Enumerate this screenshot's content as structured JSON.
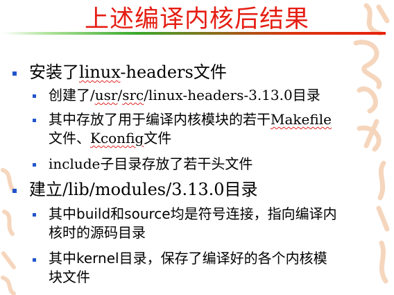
{
  "slide": {
    "title": "上述编译内核后结果",
    "items": [
      {
        "pre": "安装了",
        "code": "linux",
        "post": "-headers文件",
        "children": [
          {
            "pre": "创建了/",
            "code1": "usr",
            "mid": "/",
            "code2": "src",
            "post": "/linux-headers-3.13.0目录"
          },
          {
            "line1_pre": "其中存放了用于编译内核模块的若干",
            "line1_code": "Makefile",
            "line2_pre": "文件、",
            "line2_code": "Kconfig",
            "line2_post": "文件"
          },
          {
            "text": "include子目录存放了若干头文件"
          }
        ]
      },
      {
        "text": "建立/lib/modules/3.13.0目录",
        "children": [
          {
            "line1": "其中build和source均是符号连接，指向编译内",
            "line2": "核时的源码目录"
          },
          {
            "line1": "其中kernel目录，保存了编译好的各个内核模",
            "line2": "块文件"
          }
        ]
      }
    ]
  },
  "colors": {
    "title": "#e51d12",
    "bullet": "#2255cc",
    "underline": "#3aa82c",
    "decoration": "#f2c9a8"
  }
}
